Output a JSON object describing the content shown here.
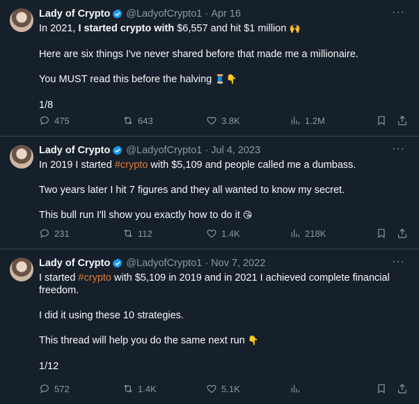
{
  "tweets": [
    {
      "name": "Lady of Crypto",
      "handle": "@LadyofCrypto1",
      "date": "Apr 16",
      "lines": [
        {
          "type": "mixed",
          "parts": [
            {
              "text": "In 2021, "
            },
            {
              "text": "I started crypto with",
              "bold": true
            },
            {
              "text": " $6,557 and hit $1 million "
            },
            {
              "text": "🙌",
              "emoji": true
            }
          ]
        },
        {
          "type": "gap"
        },
        {
          "type": "text",
          "text": "Here are six things I've never shared before that made me a millionaire."
        },
        {
          "type": "gap"
        },
        {
          "type": "mixed",
          "parts": [
            {
              "text": "You MUST read this before the halving "
            },
            {
              "text": "🧵👇",
              "emoji": true
            }
          ]
        },
        {
          "type": "gap"
        },
        {
          "type": "text",
          "text": "1/8"
        }
      ],
      "stats": {
        "replies": "475",
        "reposts": "643",
        "likes": "3.8K",
        "views": "1.2M"
      }
    },
    {
      "name": "Lady of Crypto",
      "handle": "@LadyofCrypto1",
      "date": "Jul 4, 2023",
      "lines": [
        {
          "type": "mixed",
          "parts": [
            {
              "text": "In 2019 I started "
            },
            {
              "text": "#crypto",
              "hashtag": true
            },
            {
              "text": " with $5,109 and people called me a dumbass."
            }
          ]
        },
        {
          "type": "gap"
        },
        {
          "type": "text",
          "text": "Two years later I hit 7 figures and they all wanted to know my secret."
        },
        {
          "type": "gap"
        },
        {
          "type": "mixed",
          "parts": [
            {
              "text": "This bull run I'll show you exactly how to do it "
            },
            {
              "text": "😘",
              "emoji": true
            }
          ]
        }
      ],
      "stats": {
        "replies": "231",
        "reposts": "112",
        "likes": "1.4K",
        "views": "218K"
      }
    },
    {
      "name": "Lady of Crypto",
      "handle": "@LadyofCrypto1",
      "date": "Nov 7, 2022",
      "lines": [
        {
          "type": "mixed",
          "parts": [
            {
              "text": "I started "
            },
            {
              "text": "#crypto",
              "hashtag": true
            },
            {
              "text": " with $5,109 in 2019 and in 2021 I achieved complete financial freedom."
            }
          ]
        },
        {
          "type": "gap"
        },
        {
          "type": "text",
          "text": "I did it using these 10 strategies."
        },
        {
          "type": "gap"
        },
        {
          "type": "mixed",
          "parts": [
            {
              "text": "This thread will help you do the same next run "
            },
            {
              "text": "👇",
              "emoji": true
            }
          ]
        },
        {
          "type": "gap"
        },
        {
          "type": "text",
          "text": "1/12"
        }
      ],
      "stats": {
        "replies": "572",
        "reposts": "1.4K",
        "likes": "5.1K",
        "views": ""
      }
    }
  ],
  "ui": {
    "separator": "·",
    "more": "···"
  },
  "icons": {
    "verified": "verified-badge-icon",
    "reply": "speech-bubble-icon",
    "repost": "repost-arrows-icon",
    "like": "heart-icon",
    "views": "bar-chart-icon",
    "bookmark": "bookmark-icon",
    "share": "share-upload-icon"
  },
  "colors": {
    "background": "#15202b",
    "text": "#f7f9f9",
    "muted": "#8b98a5",
    "verified": "#1d9bf0",
    "hashtag": "#e07b39",
    "divider": "#38444d"
  }
}
